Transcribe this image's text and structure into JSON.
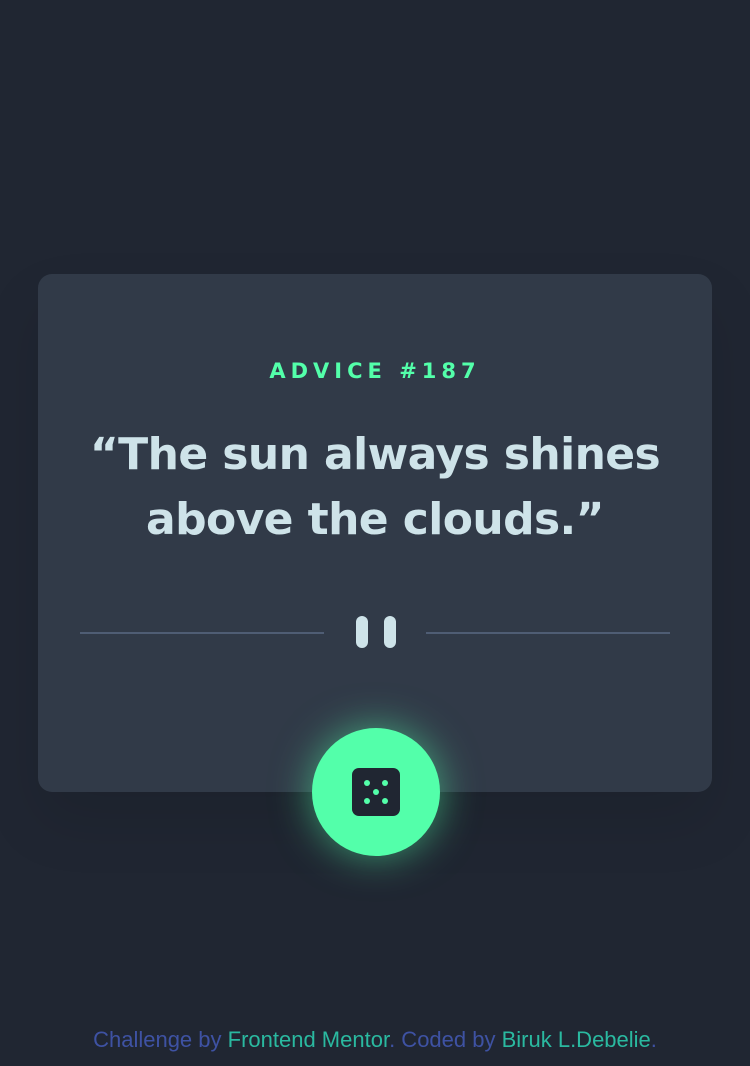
{
  "advice": {
    "heading": "ADVICE #187",
    "quote": "“The sun always shines above the clouds.”"
  },
  "dice_button": {
    "icon": "dice-icon"
  },
  "footer": {
    "prefix": "Challenge by ",
    "challenge_link": "Frontend Mentor",
    "middle": ". Coded by ",
    "author_link": "Biruk L.Debelie",
    "suffix": "."
  },
  "colors": {
    "background": "#202632",
    "card": "#313a48",
    "accent": "#53ffaa",
    "quote_text": "#cee3e9",
    "divider": "#4f5d74",
    "footer_text": "#3e52a3",
    "footer_link": "#2ab9a0"
  }
}
